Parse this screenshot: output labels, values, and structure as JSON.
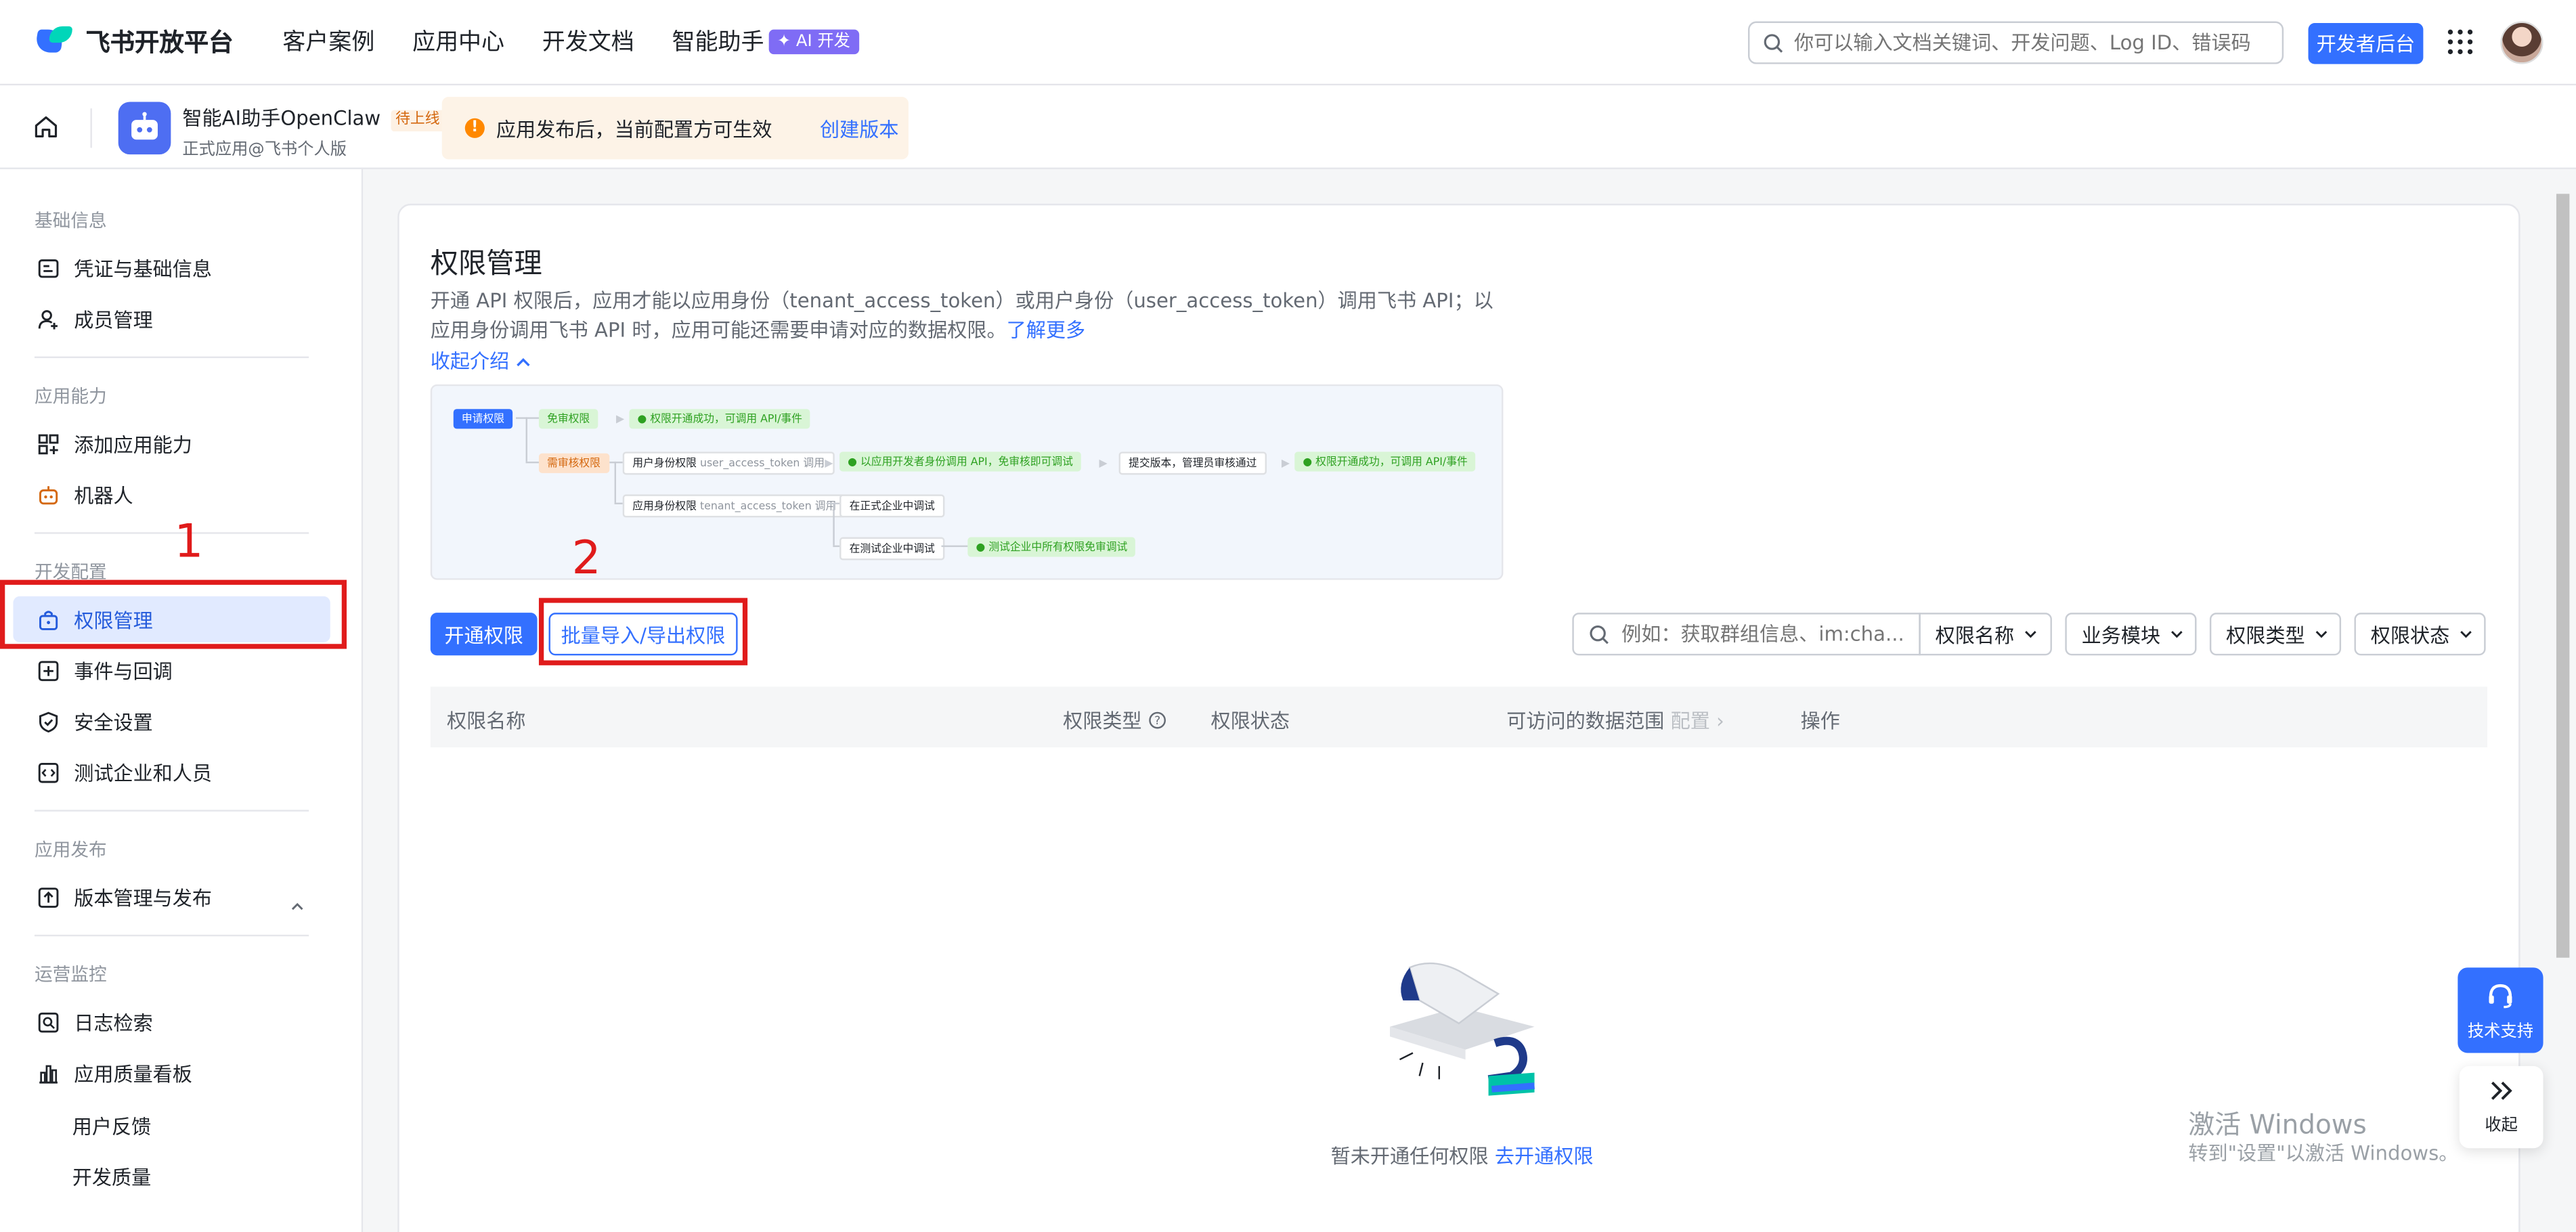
{
  "topnav": {
    "logo_text": "飞书开放平台",
    "links": [
      "客户案例",
      "应用中心",
      "开发文档",
      "智能助手"
    ],
    "ai_badge": "AI 开发",
    "search_placeholder": "你可以输入文档关键词、开发问题、Log ID、错误码",
    "dev_button": "开发者后台"
  },
  "subheader": {
    "app_name": "智能AI助手OpenClaw",
    "app_status": "待上线",
    "app_sub": "正式应用@飞书个人版",
    "notice_text": "应用发布后，当前配置方可生效",
    "notice_link": "创建版本"
  },
  "sidebar": {
    "sections": [
      {
        "title": "基础信息",
        "items": [
          "凭证与基础信息",
          "成员管理"
        ]
      },
      {
        "title": "应用能力",
        "items": [
          "添加应用能力",
          "机器人"
        ]
      },
      {
        "title": "开发配置",
        "items": [
          "权限管理",
          "事件与回调",
          "安全设置",
          "测试企业和人员"
        ]
      },
      {
        "title": "应用发布",
        "items": [
          "版本管理与发布"
        ]
      },
      {
        "title": "运营监控",
        "items": [
          "日志检索",
          "应用质量看板"
        ]
      }
    ],
    "sub_items": [
      "用户反馈",
      "开发质量"
    ]
  },
  "annotations": {
    "one": "1",
    "two": "2"
  },
  "main": {
    "title": "权限管理",
    "desc": "开通 API 权限后，应用才能以应用身份（tenant_access_token）或用户身份（user_access_token）调用飞书 API；以应用身份调用飞书 API 时，应用可能还需要申请对应的数据权限。",
    "desc_link": "了解更多",
    "collapse": "收起介绍",
    "flow": {
      "apply": "申请权限",
      "free": "免审权限",
      "free_result": "权限开通成功，可调用 API/事件",
      "review": "需审核权限",
      "user_perm": "用户身份权限",
      "user_token": "user_access_token 调用",
      "dev_call": "以应用开发者身份调用 API，免审核即可调试",
      "submit": "提交版本，管理员审核通过",
      "final": "权限开通成功，可调用 API/事件",
      "app_perm": "应用身份权限",
      "tenant_token": "tenant_access_token 调用",
      "prod_debug": "在正式企业中调试",
      "test_debug": "在测试企业中调试",
      "test_free": "测试企业中所有权限免审调试"
    },
    "btn_open": "开通权限",
    "btn_batch": "批量导入/导出权限",
    "filter_placeholder": "例如：获取群组信息、im:cha...",
    "filters": [
      "权限名称",
      "业务模块",
      "权限类型",
      "权限状态"
    ],
    "table_headers": [
      "权限名称",
      "权限类型",
      "权限状态",
      "可访问的数据范围",
      "操作"
    ],
    "config_label": "配置",
    "empty_text": "暂未开通任何权限",
    "empty_link": "去开通权限"
  },
  "float": {
    "support": "技术支持",
    "collapse": "收起"
  },
  "watermark": {
    "line1": "激活 Windows",
    "line2": "转到\"设置\"以激活 Windows。"
  }
}
